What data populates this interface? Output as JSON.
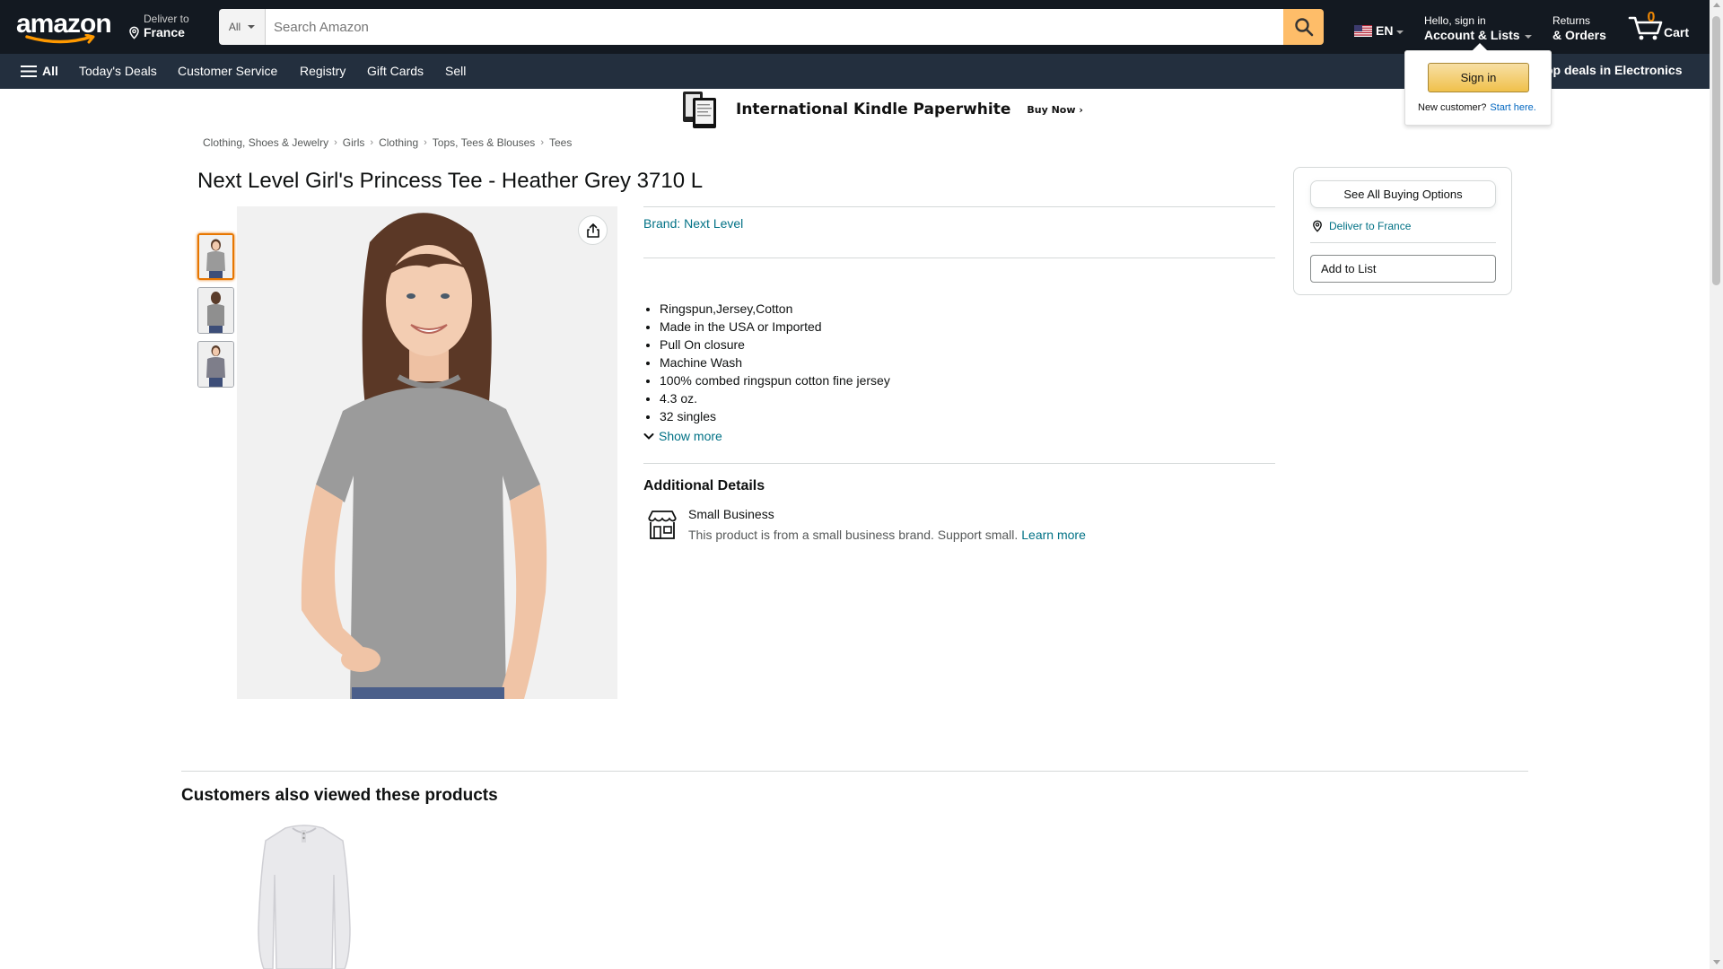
{
  "header": {
    "deliver_line1": "Deliver to",
    "deliver_line2": "France",
    "search_dept": "All",
    "search_placeholder": "Search Amazon",
    "lang": "EN",
    "account_line1": "Hello, sign in",
    "account_line2": "Account & Lists",
    "returns_line1": "Returns",
    "returns_line2": "& Orders",
    "cart_count": "0",
    "cart_label": "Cart"
  },
  "subnav": {
    "all_label": "All",
    "items": [
      "Today's Deals",
      "Customer Service",
      "Registry",
      "Gift Cards",
      "Sell"
    ],
    "promo": "op deals in Electronics"
  },
  "flyout": {
    "signin_label": "Sign in",
    "new_customer": "New customer?",
    "start_here": "Start here."
  },
  "banner": {
    "title": "International Kindle Paperwhite",
    "cta": "Buy Now ›"
  },
  "breadcrumb": [
    "Clothing, Shoes & Jewelry",
    "Girls",
    "Clothing",
    "Tops, Tees & Blouses",
    "Tees"
  ],
  "product": {
    "title": "Next Level Girl's Princess Tee - Heather Grey 3710 L",
    "brand": "Brand: Next Level",
    "bullets": [
      "Ringspun,Jersey,Cotton",
      "Made in the USA or Imported",
      "Pull On closure",
      "Machine Wash",
      "100% combed ringspun cotton fine jersey",
      "4.3 oz.",
      "32 singles"
    ],
    "show_more": "Show more",
    "additional_heading": "Additional Details",
    "small_business_title": "Small Business",
    "small_business_desc": "This product is from a small business brand. Support small.",
    "learn_more": "Learn more"
  },
  "buybox": {
    "see_all": "See All Buying Options",
    "deliver": "Deliver to France",
    "add_to_list": "Add to List"
  },
  "also_viewed": {
    "title": "Customers also viewed these products"
  },
  "colors": {
    "nav_dark": "#131921",
    "nav_sub": "#232f3e",
    "search_button": "#febd69",
    "link": "#007185",
    "cart_count": "#f08804"
  }
}
